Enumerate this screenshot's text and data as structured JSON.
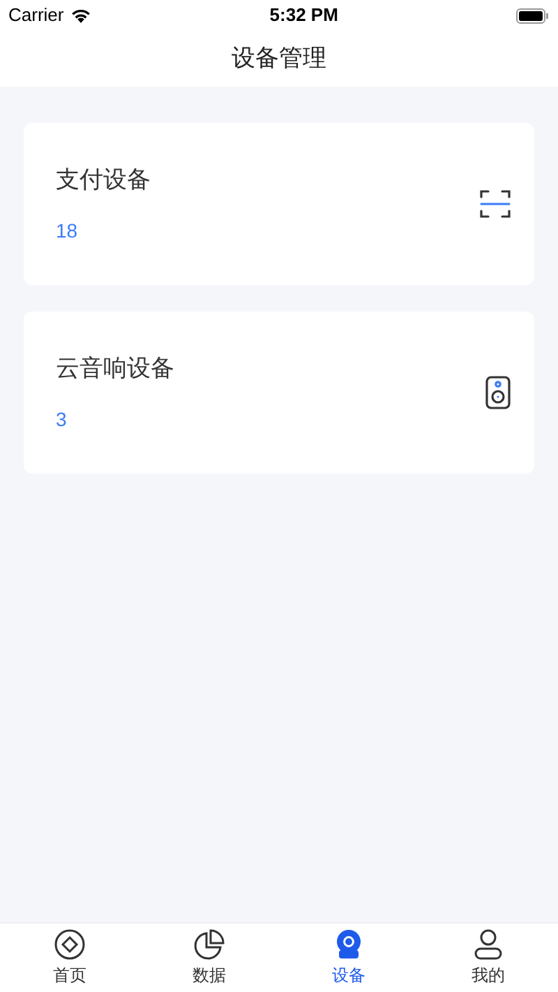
{
  "status_bar": {
    "carrier": "Carrier",
    "time": "5:32 PM"
  },
  "title": "设备管理",
  "cards": [
    {
      "kind": "scan",
      "name": "支付设备",
      "count": "18"
    },
    {
      "kind": "speaker",
      "name": "云音响设备",
      "count": "3"
    }
  ],
  "tabs": [
    {
      "kind": "home",
      "label": "首页",
      "selected": false
    },
    {
      "kind": "data",
      "label": "数据",
      "selected": false
    },
    {
      "kind": "device",
      "label": "设备",
      "selected": true
    },
    {
      "kind": "me",
      "label": "我的",
      "selected": false
    }
  ]
}
